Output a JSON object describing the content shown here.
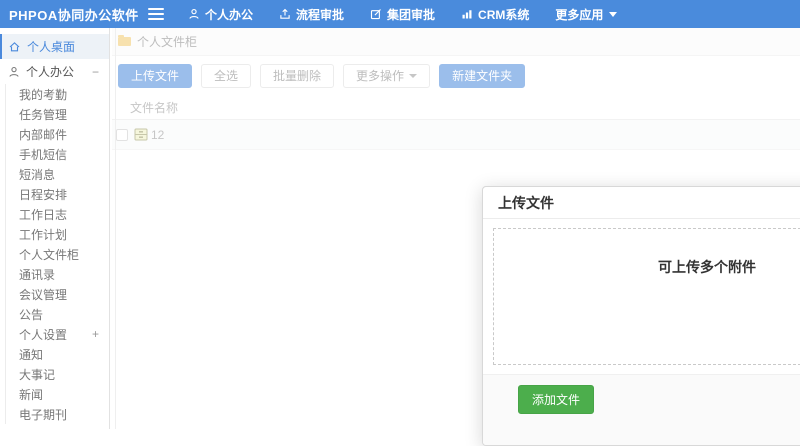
{
  "colors": {
    "navbar_blue": "#4a8bdc",
    "accent_blue": "#4a89dc",
    "green_button": "#4cae4c",
    "folder_yellow": "#f2c96d"
  },
  "navbar": {
    "logo": "PHPOA协同办公软件",
    "items": [
      {
        "label": "个人办公",
        "icon": "person-icon"
      },
      {
        "label": "流程审批",
        "icon": "approval-icon"
      },
      {
        "label": "集团审批",
        "icon": "edit-icon"
      },
      {
        "label": "CRM系统",
        "icon": "chart-icon"
      },
      {
        "label": "更多应用",
        "icon": "caret-down-icon"
      }
    ]
  },
  "sidebar": {
    "items": [
      {
        "label": "个人桌面",
        "icon": "home-icon",
        "active": true
      },
      {
        "label": "个人办公",
        "icon": "user-icon",
        "suffix": "−"
      },
      {
        "label": "我的考勤"
      },
      {
        "label": "任务管理"
      },
      {
        "label": "内部邮件"
      },
      {
        "label": "手机短信"
      },
      {
        "label": "短消息"
      },
      {
        "label": "日程安排"
      },
      {
        "label": "工作日志"
      },
      {
        "label": "工作计划"
      },
      {
        "label": "个人文件柜"
      },
      {
        "label": "通讯录"
      },
      {
        "label": "会议管理"
      },
      {
        "label": "公告"
      },
      {
        "label": "个人设置",
        "suffix": "+"
      },
      {
        "label": "通知"
      },
      {
        "label": "大事记"
      },
      {
        "label": "新闻"
      },
      {
        "label": "电子期刊"
      }
    ]
  },
  "main": {
    "breadcrumb": {
      "label": "个人文件柜",
      "icon": "folder-icon"
    },
    "toolbar": {
      "buttons": [
        {
          "label": "上传文件",
          "style": "primary"
        },
        {
          "label": "全选",
          "style": "default"
        },
        {
          "label": "批量删除",
          "style": "default"
        },
        {
          "label": "更多操作",
          "style": "dropdown"
        },
        {
          "label": "新建文件夹",
          "style": "primary"
        }
      ]
    },
    "table": {
      "header": "文件名称",
      "rows": [
        {
          "name": "12",
          "icon": "cabinet-icon"
        }
      ]
    }
  },
  "dialog": {
    "title": "上传文件",
    "dropzone_text": "可上传多个附件",
    "add_file_button": "添加文件"
  }
}
